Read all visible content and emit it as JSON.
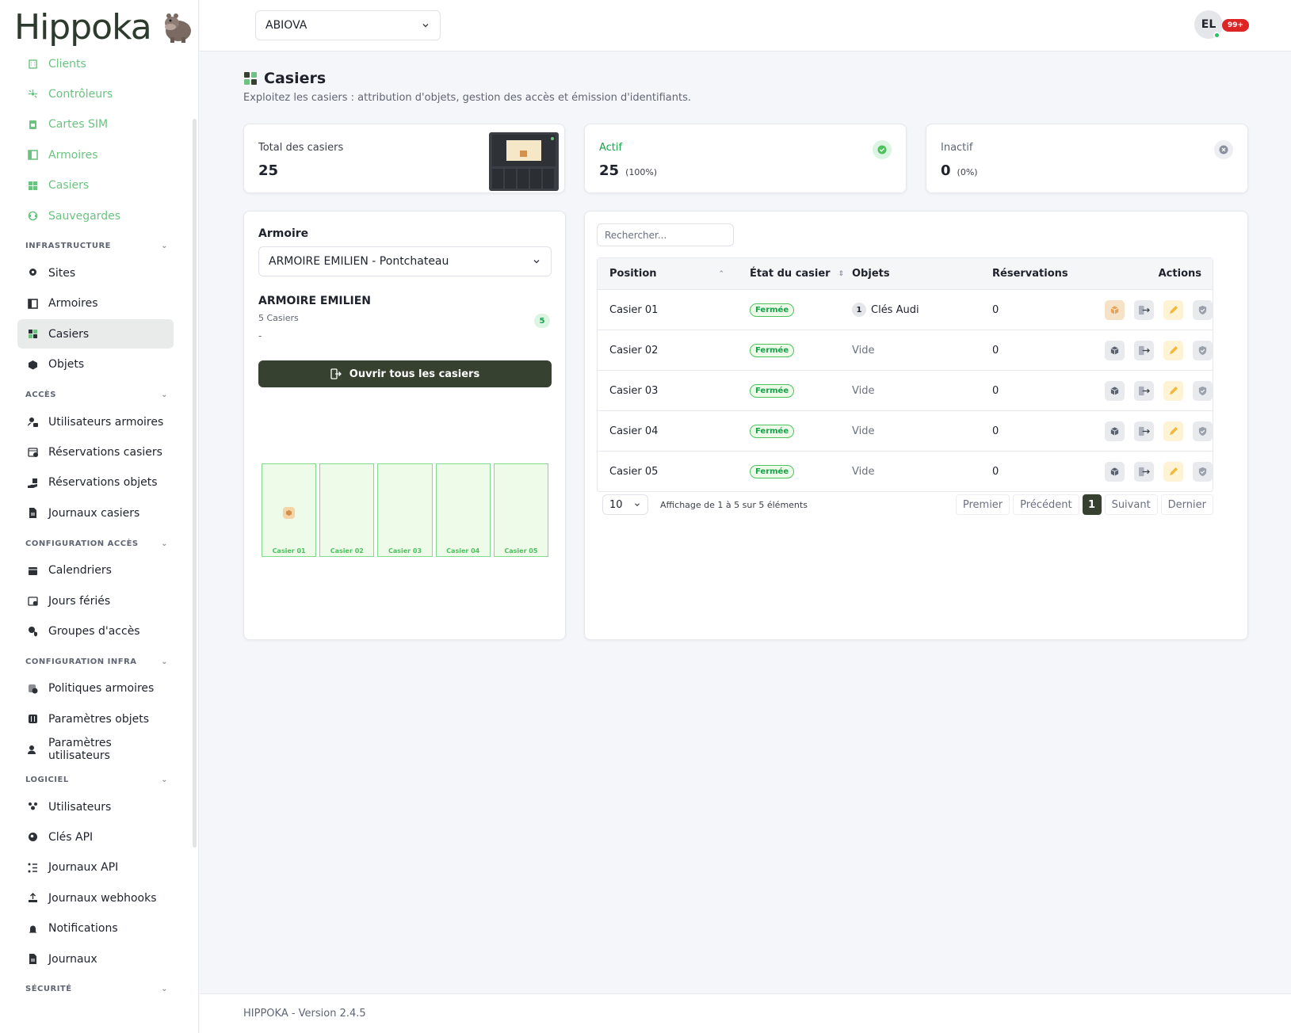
{
  "brand": {
    "name": "Hippoka"
  },
  "sidebar": {
    "top_items": [
      {
        "label": "Clients",
        "icon": "building-icon"
      },
      {
        "label": "Contrôleurs",
        "icon": "controller-icon"
      },
      {
        "label": "Cartes SIM",
        "icon": "sim-icon"
      },
      {
        "label": "Armoires",
        "icon": "cabinet-icon"
      },
      {
        "label": "Casiers",
        "icon": "grid-icon"
      },
      {
        "label": "Sauvegardes",
        "icon": "backup-icon"
      }
    ],
    "sections": [
      {
        "title": "INFRASTRUCTURE",
        "items": [
          {
            "label": "Sites",
            "icon": "location-icon"
          },
          {
            "label": "Armoires",
            "icon": "cabinet-icon"
          },
          {
            "label": "Casiers",
            "icon": "grid-icon",
            "active": true
          },
          {
            "label": "Objets",
            "icon": "box-icon"
          }
        ]
      },
      {
        "title": "ACCÈS",
        "items": [
          {
            "label": "Utilisateurs armoires",
            "icon": "user-lock-icon"
          },
          {
            "label": "Réservations casiers",
            "icon": "calendar-clock-icon"
          },
          {
            "label": "Réservations objets",
            "icon": "hand-box-icon"
          },
          {
            "label": "Journaux casiers",
            "icon": "file-log-icon"
          }
        ]
      },
      {
        "title": "CONFIGURATION ACCÈS",
        "items": [
          {
            "label": "Calendriers",
            "icon": "calendar-icon"
          },
          {
            "label": "Jours fériés",
            "icon": "calendar-star-icon"
          },
          {
            "label": "Groupes d'accès",
            "icon": "users-shield-icon"
          }
        ]
      },
      {
        "title": "CONFIGURATION INFRA",
        "items": [
          {
            "label": "Politiques armoires",
            "icon": "policy-icon"
          },
          {
            "label": "Paramètres objets",
            "icon": "sliders-icon"
          },
          {
            "label": "Paramètres utilisateurs",
            "icon": "user-gear-icon"
          }
        ]
      },
      {
        "title": "LOGICIEL",
        "items": [
          {
            "label": "Utilisateurs",
            "icon": "users-icon"
          },
          {
            "label": "Clés API",
            "icon": "key-icon"
          },
          {
            "label": "Journaux API",
            "icon": "list-icon"
          },
          {
            "label": "Journaux webhooks",
            "icon": "upload-icon"
          },
          {
            "label": "Notifications",
            "icon": "bell-icon"
          },
          {
            "label": "Journaux",
            "icon": "file-icon"
          }
        ]
      },
      {
        "title": "SÉCURITÉ",
        "items": []
      }
    ]
  },
  "header": {
    "tenant": "ABIOVA",
    "avatar_initials": "EL",
    "notifications": "99+"
  },
  "page": {
    "title": "Casiers",
    "subtitle": "Exploitez les casiers : attribution d'objets, gestion des accès et émission d'identifiants."
  },
  "stats": {
    "total": {
      "label": "Total des casiers",
      "value": "25"
    },
    "active": {
      "label": "Actif",
      "value": "25",
      "pct": "(100%)"
    },
    "inactive": {
      "label": "Inactif",
      "value": "0",
      "pct": "(0%)"
    }
  },
  "cabinet": {
    "field_label": "Armoire",
    "selected": "ARMOIRE EMILIEN - Pontchateau",
    "name": "ARMOIRE EMILIEN",
    "count_text": "5 Casiers",
    "count_badge": "5",
    "dash": "-",
    "open_all": "Ouvrir tous les casiers",
    "lockers": [
      {
        "label": "Casier 01",
        "has_object": true
      },
      {
        "label": "Casier 02",
        "has_object": false
      },
      {
        "label": "Casier 03",
        "has_object": false
      },
      {
        "label": "Casier 04",
        "has_object": false
      },
      {
        "label": "Casier 05",
        "has_object": false
      }
    ]
  },
  "table": {
    "search_placeholder": "Rechercher...",
    "headers": {
      "position": "Position",
      "state": "État du casier",
      "objects": "Objets",
      "reservations": "Réservations",
      "actions": "Actions"
    },
    "rows": [
      {
        "position": "Casier 01",
        "state": "Fermée",
        "obj_count": "1",
        "objects": "Clés Audi",
        "reservations": "0"
      },
      {
        "position": "Casier 02",
        "state": "Fermée",
        "obj_count": "",
        "objects": "Vide",
        "reservations": "0"
      },
      {
        "position": "Casier 03",
        "state": "Fermée",
        "obj_count": "",
        "objects": "Vide",
        "reservations": "0"
      },
      {
        "position": "Casier 04",
        "state": "Fermée",
        "obj_count": "",
        "objects": "Vide",
        "reservations": "0"
      },
      {
        "position": "Casier 05",
        "state": "Fermée",
        "obj_count": "",
        "objects": "Vide",
        "reservations": "0"
      }
    ],
    "per_page": "10",
    "info": "Affichage de 1 à 5 sur 5 éléments",
    "pager": {
      "first": "Premier",
      "prev": "Précédent",
      "current": "1",
      "next": "Suivant",
      "last": "Dernier"
    }
  },
  "footer": {
    "text": "HIPPOKA - Version 2.4.5"
  }
}
